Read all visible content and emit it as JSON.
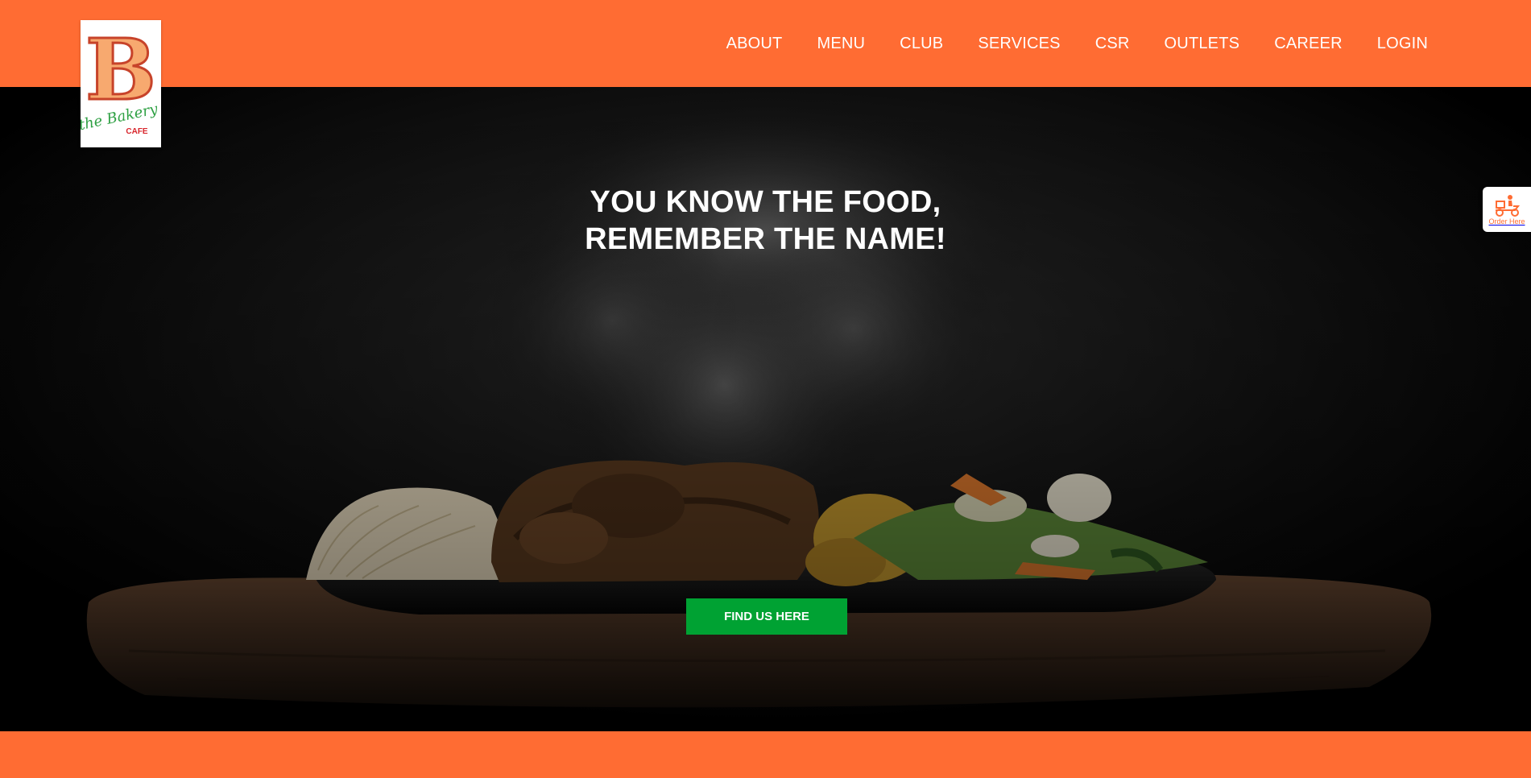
{
  "brand": {
    "logo_letter": "B",
    "logo_wordmark": "the Bakery",
    "logo_sub": "CAFE",
    "colors": {
      "orange": "#ff6c33",
      "green": "#00a233"
    }
  },
  "nav": {
    "items": [
      "ABOUT",
      "MENU",
      "CLUB",
      "SERVICES",
      "CSR",
      "OUTLETS",
      "CAREER",
      "LOGIN"
    ]
  },
  "hero": {
    "headline_line1": "YOU KNOW THE FOOD,",
    "headline_line2": "REMEMBER THE NAME!",
    "cta_label": "FIND US HERE"
  },
  "order_tab": {
    "label": "Order Here",
    "icon": "delivery-scooter-icon"
  }
}
